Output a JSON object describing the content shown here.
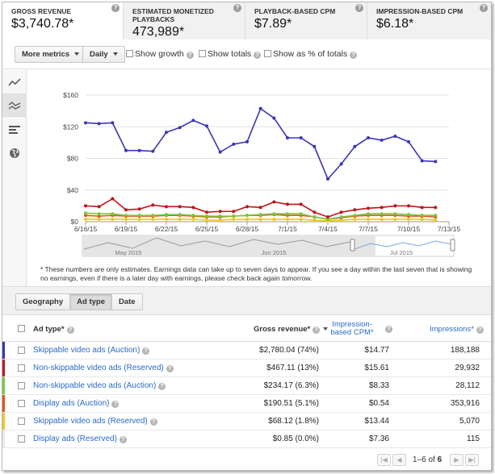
{
  "cards": [
    {
      "label": "GROSS REVENUE",
      "value": "$3,740.78*",
      "help": "?"
    },
    {
      "label": "ESTIMATED MONETIZED PLAYBACKS",
      "value": "473,989*",
      "help": "?"
    },
    {
      "label": "PLAYBACK-BASED CPM",
      "value": "$7.89*",
      "help": "?"
    },
    {
      "label": "IMPRESSION-BASED CPM",
      "value": "$6.18*",
      "help": "?"
    }
  ],
  "controls": {
    "more_metrics": "More metrics",
    "granularity": "Daily",
    "show_growth": "Show growth",
    "show_totals": "Show totals",
    "show_percent": "Show as % of totals"
  },
  "sidebar_icons": [
    "line-chart-icon",
    "multi-line-chart-icon",
    "bar-chart-icon",
    "globe-icon"
  ],
  "chart_data": {
    "type": "line",
    "title": "",
    "ylim": [
      0,
      160
    ],
    "yticks": [
      "$0",
      "$40",
      "$80",
      "$120",
      "$160"
    ],
    "xticks": [
      "6/16/15",
      "6/19/15",
      "6/22/15",
      "6/25/15",
      "6/28/15",
      "7/1/15",
      "7/4/15",
      "7/7/15",
      "7/10/15",
      "7/13/15"
    ],
    "x": [
      "6/16/15",
      "6/17/15",
      "6/18/15",
      "6/19/15",
      "6/20/15",
      "6/21/15",
      "6/22/15",
      "6/23/15",
      "6/24/15",
      "6/25/15",
      "6/26/15",
      "6/27/15",
      "6/28/15",
      "6/29/15",
      "6/30/15",
      "7/1/15",
      "7/2/15",
      "7/3/15",
      "7/4/15",
      "7/5/15",
      "7/6/15",
      "7/7/15",
      "7/8/15",
      "7/9/15",
      "7/10/15",
      "7/11/15",
      "7/12/15",
      "7/13/15"
    ],
    "series": [
      {
        "color": "#3b35b5",
        "values": [
          125,
          124,
          125,
          90,
          90,
          89,
          113,
          119,
          128,
          121,
          88,
          98,
          101,
          143,
          131,
          106,
          106,
          95,
          54,
          73,
          95,
          106,
          103,
          108,
          101,
          77,
          76,
          null
        ]
      },
      {
        "color": "#c0141a",
        "values": [
          20,
          19,
          29,
          15,
          16,
          21,
          19,
          19,
          18,
          12,
          13,
          13,
          19,
          18,
          25,
          22,
          22,
          12,
          6,
          12,
          15,
          17,
          18,
          20,
          20,
          18,
          18,
          null
        ]
      },
      {
        "color": "#78c83c",
        "values": [
          11,
          10,
          10,
          8,
          8,
          8,
          9,
          9,
          8,
          7,
          7,
          7,
          8,
          9,
          10,
          10,
          10,
          6,
          3,
          6,
          8,
          10,
          10,
          10,
          9,
          8,
          8,
          null
        ]
      },
      {
        "color": "#e0541e",
        "values": [
          8,
          7,
          8,
          7,
          7,
          7,
          8,
          8,
          7,
          6,
          6,
          7,
          8,
          8,
          9,
          8,
          8,
          6,
          3,
          5,
          7,
          8,
          8,
          8,
          7,
          7,
          6,
          null
        ]
      },
      {
        "color": "#f0c81e",
        "values": [
          3,
          3,
          3,
          3,
          3,
          3,
          3,
          3,
          3,
          2,
          2,
          3,
          3,
          3,
          3,
          3,
          3,
          2,
          1,
          2,
          3,
          3,
          3,
          3,
          3,
          3,
          2,
          null
        ]
      }
    ],
    "navigator_labels": [
      "May 2015",
      "Jun 2015",
      "Jul 2015"
    ]
  },
  "note": "* These numbers are only estimates. Earnings data can take up to seven days to appear. If you see a day within the last seven that is showing no earnings, even if there is a later day with earnings, please check back again tomorrow.",
  "tabs": [
    "Geography",
    "Ad type",
    "Date"
  ],
  "table": {
    "headers": {
      "name": "Ad type*",
      "gross": "Gross revenue*",
      "cpm": "Impression-based CPM*",
      "impressions": "Impressions*"
    },
    "rows": [
      {
        "name": "Skippable video ads (Auction)",
        "gross": "$2,780.04 (74%)",
        "cpm": "$14.77",
        "impressions": "188,188",
        "color": "#3b35b5"
      },
      {
        "name": "Non-skippable video ads (Reserved)",
        "gross": "$467.11 (13%)",
        "cpm": "$15.61",
        "impressions": "29,932",
        "color": "#c0141a"
      },
      {
        "name": "Non-skippable video ads (Auction)",
        "gross": "$234.17 (6.3%)",
        "cpm": "$8.33",
        "impressions": "28,112",
        "color": "#78c83c"
      },
      {
        "name": "Display ads (Auction)",
        "gross": "$190.51 (5.1%)",
        "cpm": "$0.54",
        "impressions": "353,916",
        "color": "#e0541e"
      },
      {
        "name": "Skippable video ads (Reserved)",
        "gross": "$68.12 (1.8%)",
        "cpm": "$13.44",
        "impressions": "5,070",
        "color": "#f0c81e"
      },
      {
        "name": "Display ads (Reserved)",
        "gross": "$0.85 (0.0%)",
        "cpm": "$7.36",
        "impressions": "115",
        "color": "#e9e9e9"
      }
    ]
  },
  "pager": {
    "range": "1–6",
    "of": "of",
    "total": "6"
  }
}
